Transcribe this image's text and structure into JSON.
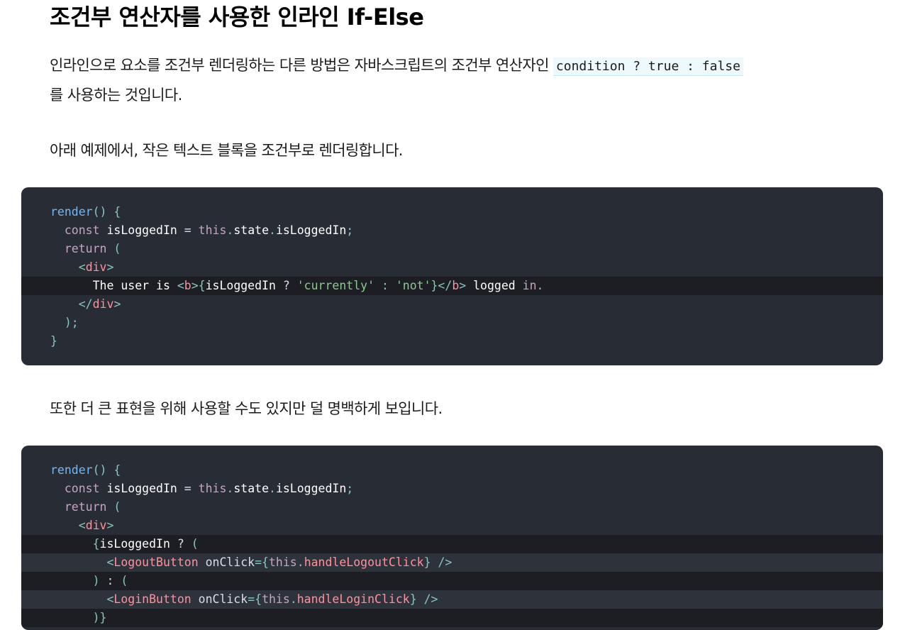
{
  "heading": "조건부 연산자를 사용한 인라인 If-Else",
  "para1": {
    "before": "인라인으로 요소를 조건부 렌더링하는 다른 방법은 자바스크립트의 조건부 연산자인 ",
    "code": "condition ? true : false",
    "after": " 를 사용하는 것입니다."
  },
  "para2": "아래 예제에서, 작은 텍스트 블록을 조건부로 렌더링합니다.",
  "para3": "또한 더 큰 표현을 위해 사용할 수도 있지만 덜 명백하게 보입니다.",
  "code1": {
    "lines": [
      "render() {",
      "  const isLoggedIn = this.state.isLoggedIn;",
      "  return (",
      "    <div>",
      "      The user is <b>{isLoggedIn ? 'currently' : 'not'}</b> logged in.",
      "    </div>",
      "  );",
      "}"
    ],
    "highlighted_line": 5
  },
  "code2": {
    "lines": [
      "render() {",
      "  const isLoggedIn = this.state.isLoggedIn;",
      "  return (",
      "    <div>",
      "      {isLoggedIn ? (",
      "        <LogoutButton onClick={this.handleLogoutClick} />",
      "      ) : (",
      "        <LoginButton onClick={this.handleLoginClick} />",
      "      )}"
    ],
    "highlighted_lines": [
      5,
      6,
      7,
      8
    ]
  },
  "colors": {
    "code_bg": "#282c34",
    "code_highlight": "#1c1e23",
    "inline_code_bg": "#eef9fd",
    "keyword": "#c5a5c5",
    "function": "#79b6f2",
    "punctuation": "#88c6be",
    "tag": "#fc929e",
    "string": "#8dc891"
  }
}
